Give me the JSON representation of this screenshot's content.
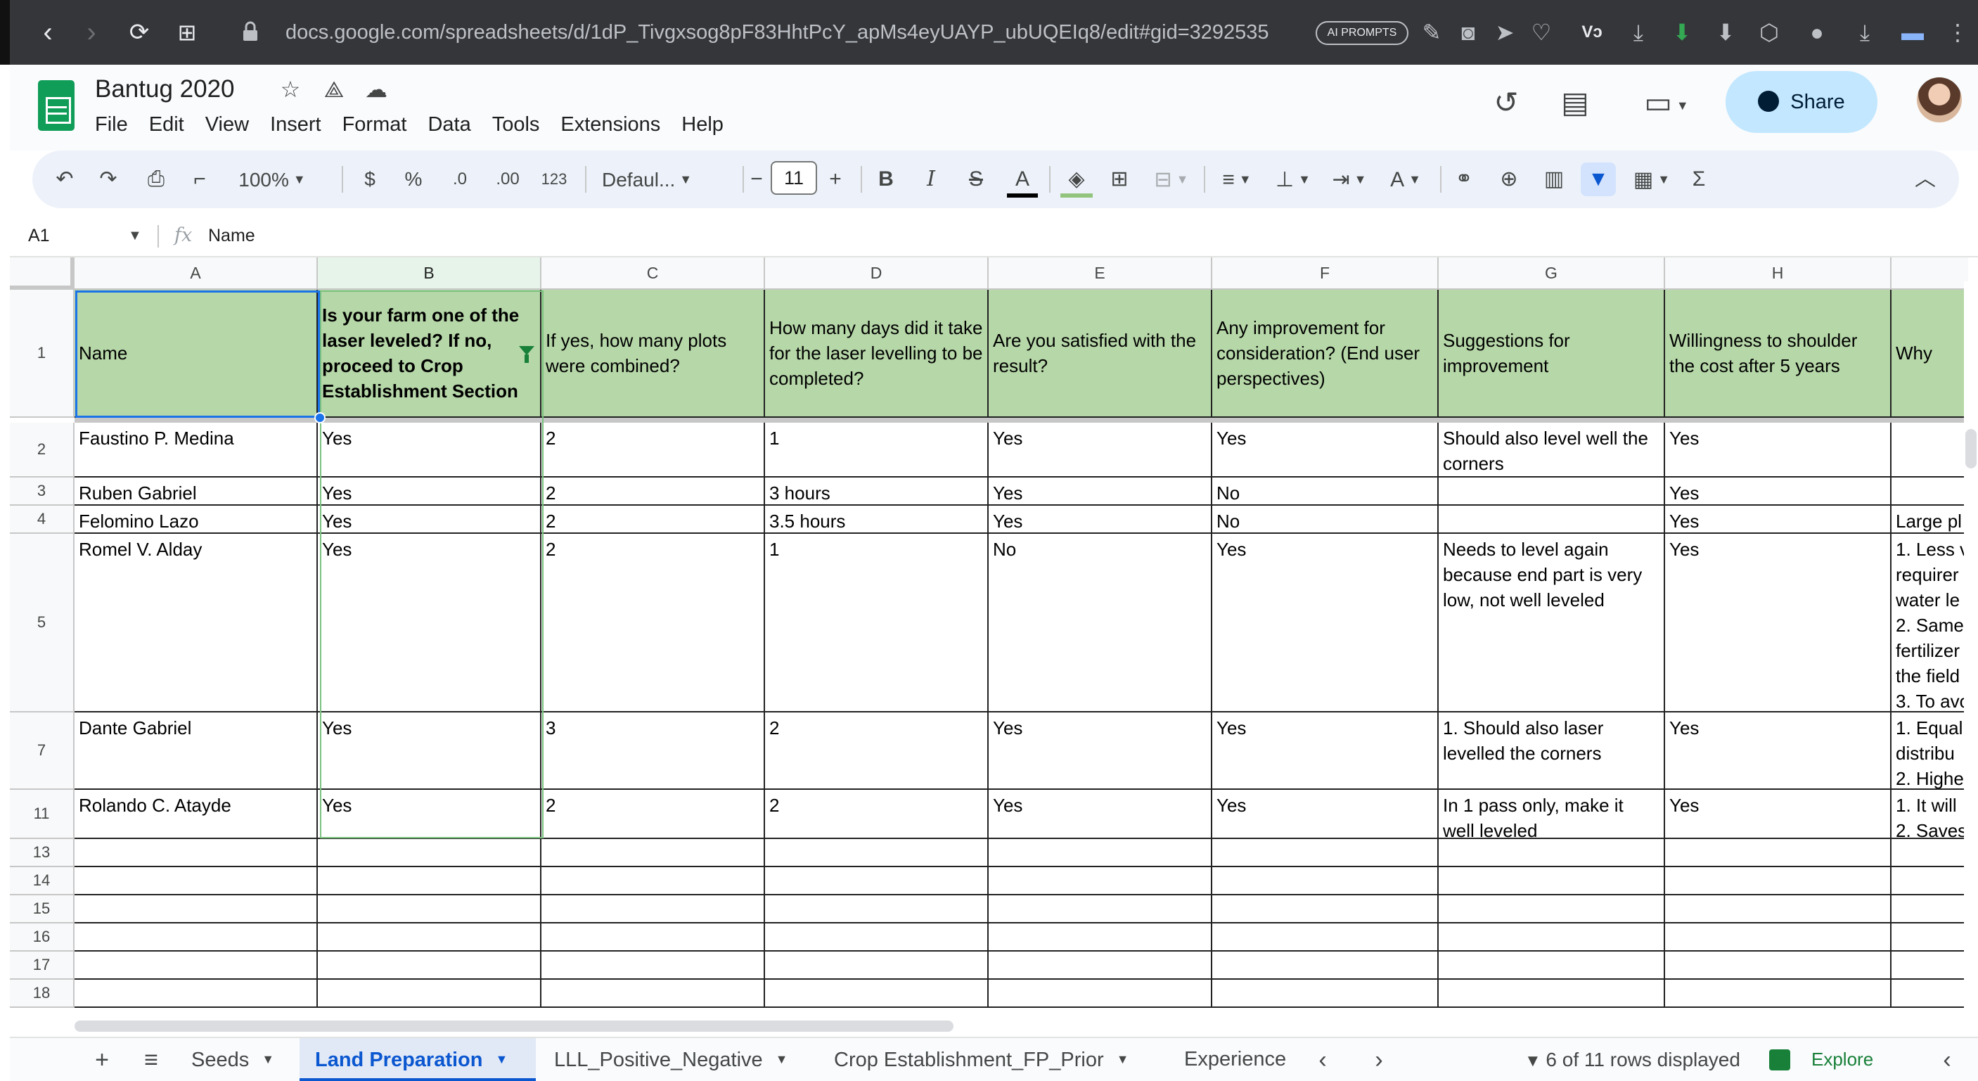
{
  "browser": {
    "url": "docs.google.com/spreadsheets/d/1dP_Tivgxsog8pF83HhtPcY_apMs4eyUAYP_ubUQEIq8/edit#gid=3292535",
    "url_host": "docs.google.com",
    "ai_badge": "AI PROMPTS",
    "back_icon": "‹",
    "forward_icon": "›",
    "reload_icon": "⟳",
    "tabs_icon": "⊞",
    "lock_icon": "🔒"
  },
  "app": {
    "title": "Bantug 2020",
    "menu": [
      "File",
      "Edit",
      "View",
      "Insert",
      "Format",
      "Data",
      "Tools",
      "Extensions",
      "Help"
    ],
    "share_label": "Share"
  },
  "toolbar": {
    "zoom": "100%",
    "currency": "$",
    "percent": "%",
    "dec_decrease": ".0",
    "dec_increase": ".00",
    "number_format": "123",
    "font": "Defaul...",
    "font_size": "11",
    "minus": "−",
    "plus": "+",
    "bold": "B",
    "italic": "I",
    "strike": "S",
    "text_color": "A"
  },
  "formula_bar": {
    "cell_ref": "A1",
    "fx": "fx",
    "content": "Name"
  },
  "grid": {
    "columns": [
      "A",
      "B",
      "C",
      "D",
      "E",
      "F",
      "G",
      "H",
      ""
    ],
    "headers": [
      "Name",
      "Is your farm one of the laser leveled? If no, proceed to Crop Establishment Section",
      "If yes, how many plots were combined?",
      "How many days did it take for the laser levelling to be completed?",
      "Are you satisfied with the result?",
      "Any improvement for consideration? (End user perspectives)",
      "Suggestions for improvement",
      "Willingness to shoulder the cost after 5 years",
      "Why"
    ],
    "rows": [
      {
        "num": "2",
        "cells": [
          "Faustino P. Medina",
          "Yes",
          "2",
          "1",
          "Yes",
          "Yes",
          "Should also level well the corners",
          "Yes",
          ""
        ]
      },
      {
        "num": "3",
        "cells": [
          "Ruben Gabriel",
          "Yes",
          "2",
          "3 hours",
          "Yes",
          "No",
          "",
          "Yes",
          ""
        ]
      },
      {
        "num": "4",
        "cells": [
          "Felomino Lazo",
          "Yes",
          "2",
          "3.5 hours",
          "Yes",
          "No",
          "",
          "Yes",
          "Large pl"
        ]
      },
      {
        "num": "5",
        "cells": [
          "Romel V. Alday",
          "Yes",
          "2",
          "1",
          "No",
          "Yes",
          "Needs to level again because  end part is very low, not well leveled",
          "Yes",
          "1. Less v requirer water le 2. Same fertilizer the field 3. To avo"
        ]
      },
      {
        "num": "7",
        "cells": [
          "Dante Gabriel",
          "Yes",
          "3",
          "2",
          "Yes",
          "Yes",
          "1. Should also laser levelled the corners",
          "Yes",
          "1. Equal distribu 2. Highe"
        ]
      },
      {
        "num": "11",
        "cells": [
          "Rolando C. Atayde",
          "Yes",
          "2",
          "2",
          "Yes",
          "Yes",
          "In 1 pass only, make it well leveled",
          "Yes",
          "1. It will 2. Saves"
        ]
      }
    ],
    "empty_rows": [
      "13",
      "14",
      "15",
      "16",
      "17",
      "18"
    ]
  },
  "tabs": {
    "add": "+",
    "all_sheets": "≡",
    "sheets": [
      "Seeds",
      "Land Preparation",
      "LLL_Positive_Negative",
      "Crop Establishment_FP_Prior",
      "Experience"
    ],
    "active_index": 1,
    "rows_displayed": "6 of 11 rows displayed",
    "explore": "Explore"
  },
  "colors": {
    "header_fill": "#b6d7a8",
    "active_tab": "#0b57d0",
    "share_bg": "#c2e7ff",
    "sheets_green": "#0f9d58"
  }
}
